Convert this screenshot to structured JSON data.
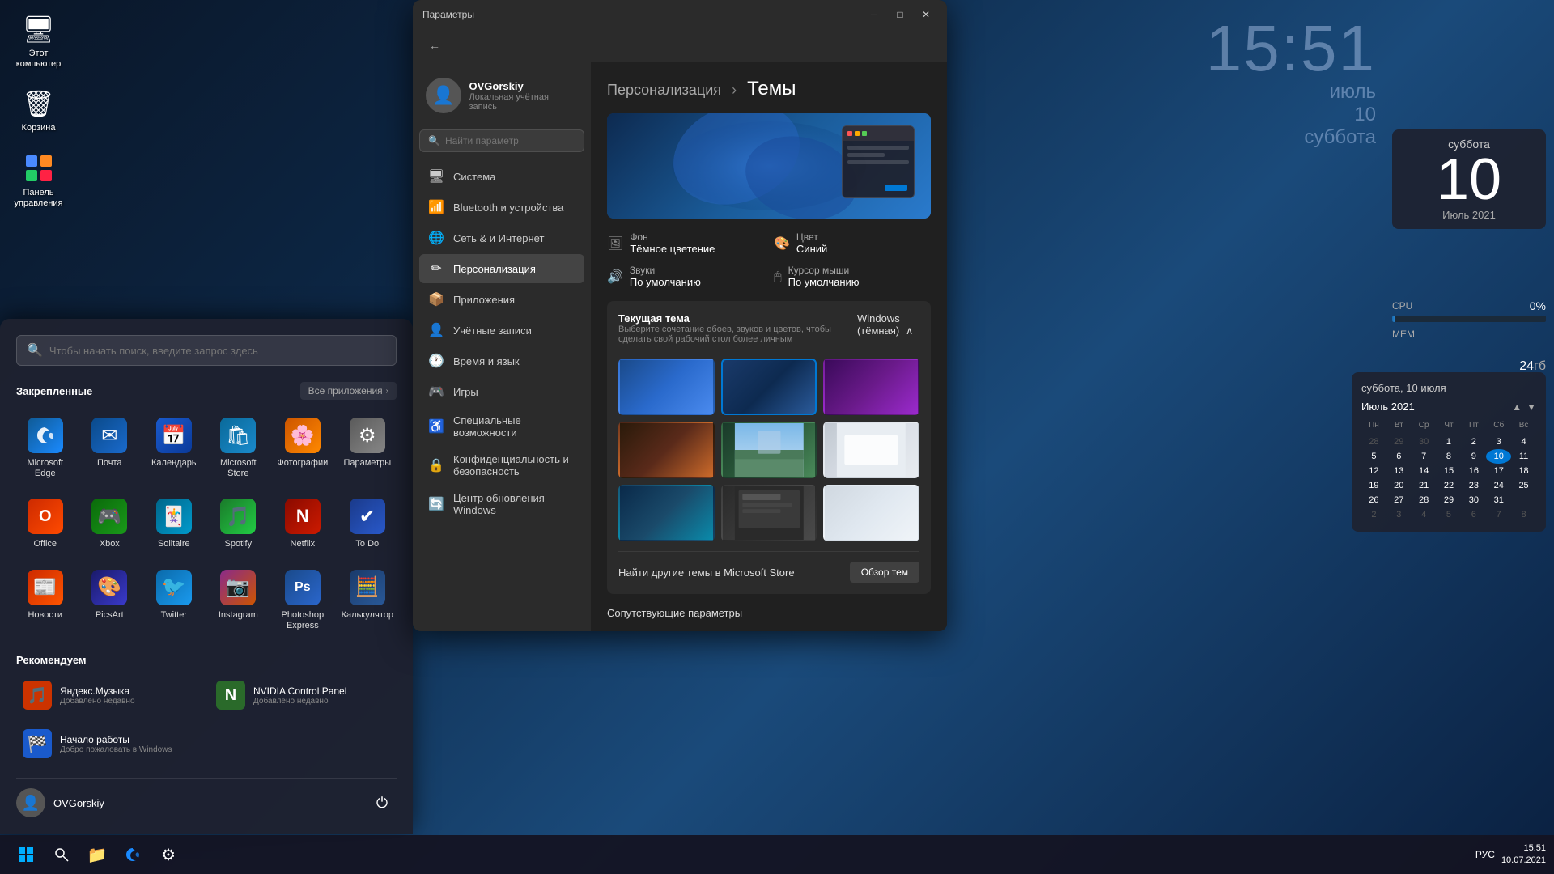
{
  "desktop": {
    "bg_color": "#0d2040"
  },
  "desktop_icons": [
    {
      "id": "computer",
      "label": "Этот\nкомпьютер",
      "icon": "🖥"
    },
    {
      "id": "recycle",
      "label": "Корзина",
      "icon": "🗑"
    },
    {
      "id": "control_panel",
      "label": "Панель\nуправления",
      "icon": "⚙"
    }
  ],
  "clock": {
    "time": "15:51",
    "month": "июль",
    "day": "10",
    "weekday": "суббота"
  },
  "sysmon": {
    "cpu_label": "CPU",
    "cpu_value": "0%",
    "cpu_fill": 2,
    "mem_label": "МЕМ",
    "mem_value": "24",
    "mem_unit": "гб"
  },
  "large_date_widget": {
    "day_name": "суббота",
    "day_num": "10",
    "month_year": "Июль 2021"
  },
  "calendar": {
    "selected_date": "суббота, 10 июля",
    "month_title": "Июль 2021",
    "days_labels": [
      "Пн",
      "Вт",
      "Ср",
      "Чт",
      "Пт",
      "Сб",
      "Вс"
    ],
    "weeks": [
      [
        "28",
        "29",
        "30",
        "1",
        "2",
        "3",
        "4"
      ],
      [
        "5",
        "6",
        "7",
        "8",
        "9",
        "10",
        "11"
      ],
      [
        "12",
        "13",
        "14",
        "15",
        "16",
        "17",
        "18"
      ],
      [
        "19",
        "20",
        "21",
        "22",
        "23",
        "24",
        "25"
      ],
      [
        "26",
        "27",
        "28",
        "29",
        "30",
        "31",
        ""
      ],
      [
        "2",
        "3",
        "4",
        "5",
        "6",
        "7",
        "8"
      ]
    ],
    "today": "10",
    "other_month_first_row": [
      true,
      true,
      true,
      false,
      false,
      false,
      false
    ],
    "other_month_last_row": [
      false,
      false,
      false,
      false,
      false,
      false,
      false
    ]
  },
  "start_menu": {
    "search_placeholder": "Чтобы начать поиск, введите запрос здесь",
    "pinned_label": "Закрепленные",
    "all_apps_label": "Все приложения",
    "pinned_apps": [
      {
        "id": "edge",
        "name": "Microsoft Edge",
        "icon": "🌐",
        "color_class": "icon-edge"
      },
      {
        "id": "mail",
        "name": "Почта",
        "icon": "✉",
        "color_class": "icon-mail"
      },
      {
        "id": "calendar",
        "name": "Календарь",
        "icon": "📅",
        "color_class": "icon-calendar"
      },
      {
        "id": "store",
        "name": "Microsoft Store",
        "icon": "🛒",
        "color_class": "icon-store"
      },
      {
        "id": "photos",
        "name": "Фотографии",
        "icon": "🌸",
        "color_class": "icon-photos"
      },
      {
        "id": "settings",
        "name": "Параметры",
        "icon": "⚙",
        "color_class": "icon-settings"
      },
      {
        "id": "office",
        "name": "Office",
        "icon": "O",
        "color_class": "icon-office"
      },
      {
        "id": "xbox",
        "name": "Xbox",
        "icon": "🎮",
        "color_class": "icon-xbox"
      },
      {
        "id": "solitaire",
        "name": "Solitaire",
        "icon": "🃏",
        "color_class": "icon-solitaire"
      },
      {
        "id": "spotify",
        "name": "Spotify",
        "icon": "🎵",
        "color_class": "icon-spotify"
      },
      {
        "id": "netflix",
        "name": "Netflix",
        "icon": "N",
        "color_class": "icon-netflix"
      },
      {
        "id": "todo",
        "name": "To Do",
        "icon": "✔",
        "color_class": "icon-todo"
      },
      {
        "id": "news",
        "name": "Новости",
        "icon": "📰",
        "color_class": "icon-news"
      },
      {
        "id": "picsart",
        "name": "PicsArt",
        "icon": "🎨",
        "color_class": "icon-picsart"
      },
      {
        "id": "twitter",
        "name": "Twitter",
        "icon": "🐦",
        "color_class": "icon-twitter"
      },
      {
        "id": "instagram",
        "name": "Instagram",
        "icon": "📷",
        "color_class": "icon-instagram"
      },
      {
        "id": "ps_express",
        "name": "Photoshop Express",
        "icon": "Ps",
        "color_class": "icon-ps"
      },
      {
        "id": "calc",
        "name": "Калькулятор",
        "icon": "🧮",
        "color_class": "icon-calc"
      }
    ],
    "recommended_label": "Рекомендуем",
    "recommended_items": [
      {
        "id": "yandex_music",
        "name": "Яндекс.Музыка",
        "sub": "Добавлено недавно",
        "icon": "🎵",
        "bg": "#cc3300"
      },
      {
        "id": "nvidia_cp",
        "name": "NVIDIA Control Panel",
        "sub": "Добавлено недавно",
        "icon": "N",
        "bg": "#2a6a2a"
      },
      {
        "id": "startup",
        "name": "Начало работы",
        "sub": "Добро пожаловать в Windows",
        "icon": "🏁",
        "bg": "#1a5acc"
      },
      {
        "id": "empty4",
        "name": "",
        "sub": "",
        "icon": "",
        "bg": ""
      }
    ],
    "user_name": "OVGorskiy",
    "user_avatar": "👤"
  },
  "settings": {
    "title": "Параметры",
    "user_name": "OVGorskiy",
    "user_sub": "Локальная учётная запись",
    "search_placeholder": "Найти параметр",
    "nav_items": [
      {
        "id": "system",
        "label": "Система",
        "icon": "🖥"
      },
      {
        "id": "bluetooth",
        "label": "Bluetooth и устройства",
        "icon": "📶"
      },
      {
        "id": "network",
        "label": "Сеть & и Интернет",
        "icon": "🌐"
      },
      {
        "id": "personalization",
        "label": "Персонализация",
        "icon": "✏",
        "active": true
      },
      {
        "id": "apps",
        "label": "Приложения",
        "icon": "📦"
      },
      {
        "id": "accounts",
        "label": "Учётные записи",
        "icon": "👤"
      },
      {
        "id": "time",
        "label": "Время и язык",
        "icon": "🕐"
      },
      {
        "id": "gaming",
        "label": "Игры",
        "icon": "🎮"
      },
      {
        "id": "accessibility",
        "label": "Специальные возможности",
        "icon": "♿"
      },
      {
        "id": "privacy",
        "label": "Конфиденциальность и безопасность",
        "icon": "🔒"
      },
      {
        "id": "windows_update",
        "label": "Центр обновления Windows",
        "icon": "🔄"
      }
    ],
    "breadcrumb_parent": "Персонализация",
    "breadcrumb_sep": ">",
    "breadcrumb_current": "Темы",
    "back_label": "←",
    "theme_meta": [
      {
        "icon": "🖼",
        "label": "Фон",
        "value": "Тёмное цветение"
      },
      {
        "icon": "🎨",
        "label": "Цвет",
        "value": "Синий"
      },
      {
        "icon": "🔊",
        "label": "Звуки",
        "value": "По умолчанию"
      },
      {
        "icon": "🖱",
        "label": "Курсор мыши",
        "value": "По умолчанию"
      }
    ],
    "current_theme_title": "Текущая тема",
    "current_theme_desc": "Выберите сочетание обоев, звуков и цветов, чтобы\nсделать свой рабочий стол более личным",
    "current_theme_name": "Windows (тёмная)",
    "theme_thumbs": [
      {
        "id": "t1",
        "cls": "thumb-win11-blue",
        "selected": false
      },
      {
        "id": "t2",
        "cls": "thumb-win11-dark",
        "selected": true
      },
      {
        "id": "t3",
        "cls": "thumb-purple",
        "selected": false
      },
      {
        "id": "t4",
        "cls": "thumb-flower",
        "selected": false
      },
      {
        "id": "t5",
        "cls": "thumb-landscape",
        "selected": false
      },
      {
        "id": "t6",
        "cls": "thumb-white",
        "selected": false
      },
      {
        "id": "t7",
        "cls": "thumb-cyan",
        "selected": false
      },
      {
        "id": "t8",
        "cls": "thumb-gray",
        "selected": false
      },
      {
        "id": "t9",
        "cls": "thumb-light",
        "selected": false
      }
    ],
    "find_themes_text": "Найти другие темы в Microsoft Store",
    "browse_btn_label": "Обзор тем",
    "related_label": "Сопутствующие параметры"
  },
  "taskbar": {
    "time": "15:51",
    "date": "10.07.2021",
    "lang": "РУС"
  }
}
